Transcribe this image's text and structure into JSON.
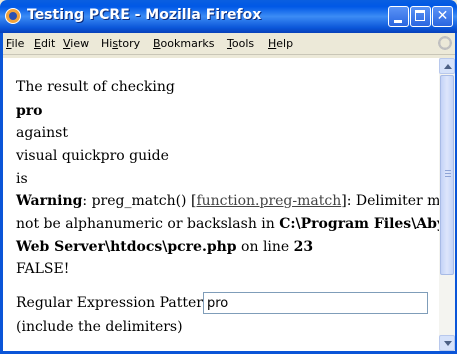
{
  "window": {
    "title": "Testing PCRE - Mozilla Firefox",
    "icon": "firefox-icon"
  },
  "menu": {
    "items": [
      {
        "acc": "F",
        "rest": "ile"
      },
      {
        "acc": "E",
        "rest": "dit"
      },
      {
        "acc": "V",
        "rest": "iew"
      },
      {
        "pre": "Hi",
        "acc": "s",
        "rest": "tory"
      },
      {
        "acc": "B",
        "rest": "ookmarks"
      },
      {
        "acc": "T",
        "rest": "ools"
      },
      {
        "acc": "H",
        "rest": "elp"
      }
    ]
  },
  "content": {
    "line1": "The result of checking",
    "pattern_bold": "pro",
    "against": "against",
    "subject": "visual quickpro guide",
    "is": "is",
    "warning_label": "Warning",
    "warning_text1": ": preg_match() [",
    "warning_link": "function.preg-match",
    "warning_text2": "]: Delimiter must",
    "warning_line2a": "not be alphanumeric or backslash in ",
    "warning_path1": "C:\\Program Files\\Abyss",
    "warning_path2": "Web Server\\htdocs\\pcre.php",
    "warning_online": " on line ",
    "warning_lineno": "23",
    "result": "FALSE!",
    "pattern_label": "Regular Expression Pattern:",
    "pattern_value": "pro",
    "hint": "(include the delimiters)"
  },
  "colors": {
    "titlebar": "#0058e6",
    "chrome": "#ece9d8",
    "scrollbar": "#d6e2fa"
  }
}
